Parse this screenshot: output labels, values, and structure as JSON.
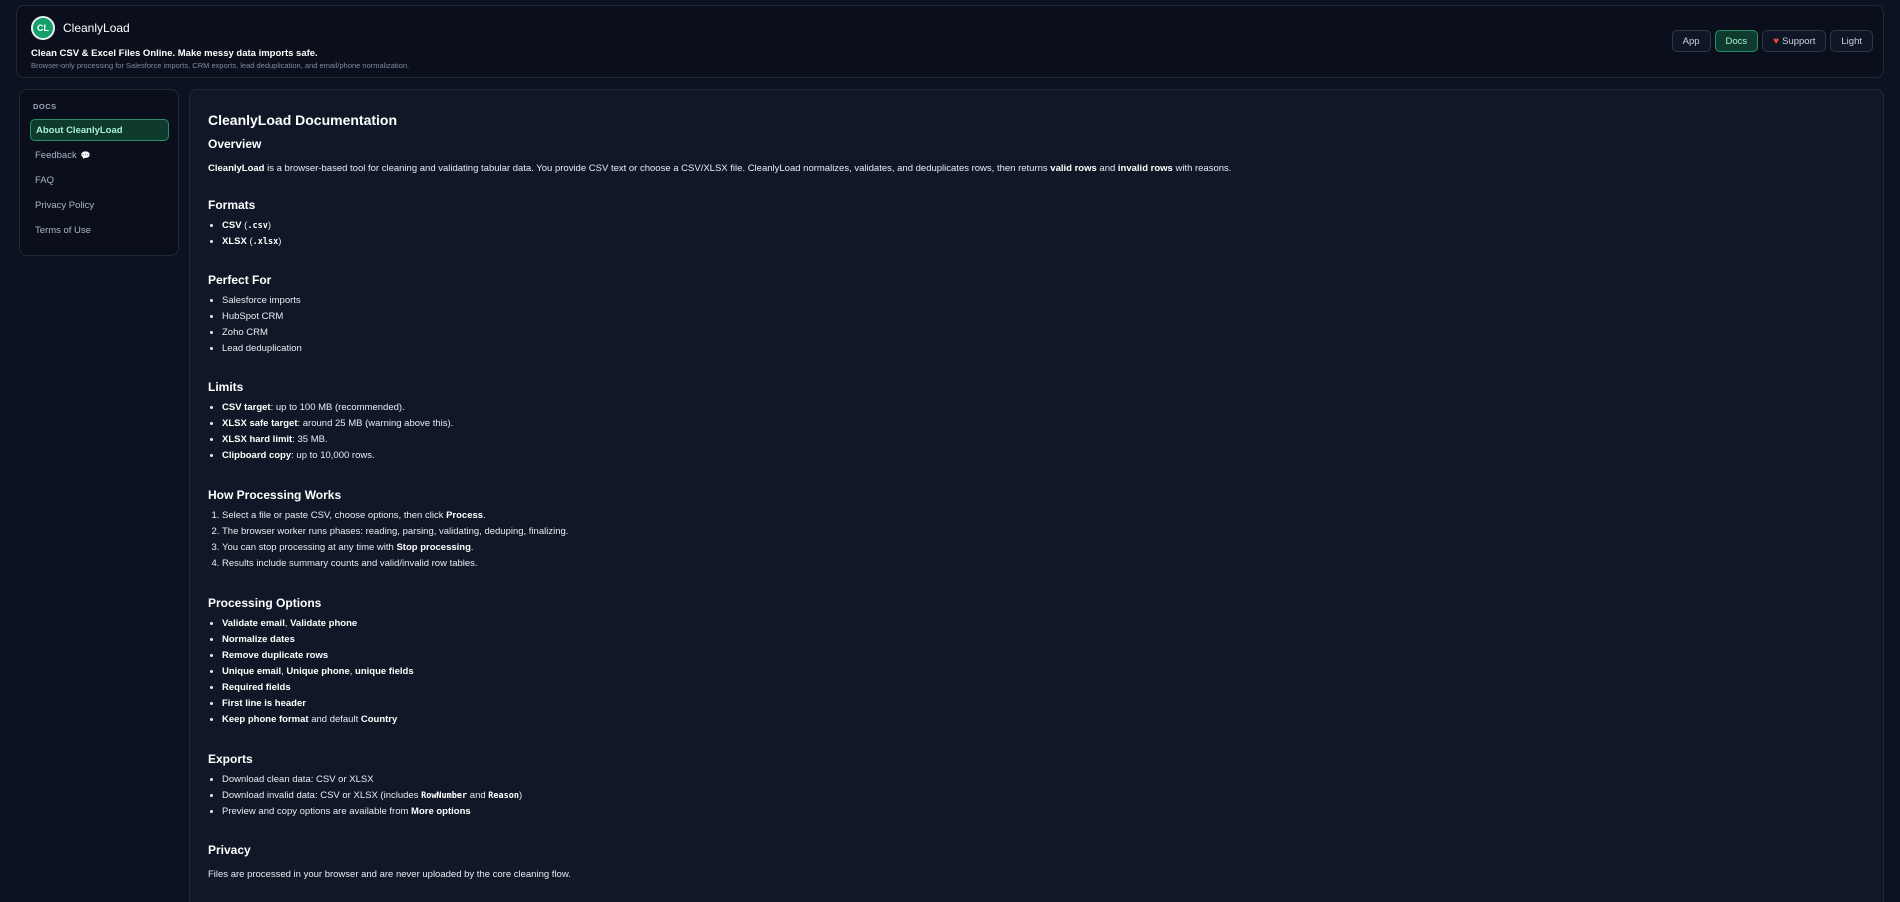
{
  "header": {
    "logo_text": "CL",
    "brand": "CleanlyLoad",
    "tagline": "Clean CSV & Excel Files Online. Make messy data imports safe.",
    "subtagline": "Browser-only processing for Salesforce imports, CRM exports, lead deduplication, and email/phone normalization.",
    "nav": {
      "app": "App",
      "docs": "Docs",
      "support": "Support",
      "theme": "Light"
    }
  },
  "sidebar": {
    "title": "DOCS",
    "items": [
      "About CleanlyLoad",
      "Feedback",
      "FAQ",
      "Privacy Policy",
      "Terms of Use"
    ]
  },
  "doc": {
    "title": "CleanlyLoad Documentation",
    "overview": {
      "heading": "Overview",
      "brand": "CleanlyLoad",
      "text1": " is a browser-based tool for cleaning and validating tabular data. You provide CSV text or choose a CSV/XLSX file. CleanlyLoad normalizes, validates, and deduplicates rows, then returns ",
      "valid": "valid rows",
      "and": " and ",
      "invalid": "invalid rows",
      "text2": " with reasons."
    },
    "formats": {
      "heading": "Formats",
      "items": [
        {
          "name": "CSV",
          "ext": ".csv"
        },
        {
          "name": "XLSX",
          "ext": ".xlsx"
        }
      ]
    },
    "perfect": {
      "heading": "Perfect For",
      "items": [
        "Salesforce imports",
        "HubSpot CRM",
        "Zoho CRM",
        "Lead deduplication"
      ]
    },
    "limits": {
      "heading": "Limits",
      "items": [
        {
          "k": "CSV target",
          "v": ": up to 100 MB (recommended)."
        },
        {
          "k": "XLSX safe target",
          "v": ": around 25 MB (warning above this)."
        },
        {
          "k": "XLSX hard limit",
          "v": ": 35 MB."
        },
        {
          "k": "Clipboard copy",
          "v": ": up to 10,000 rows."
        }
      ]
    },
    "processing": {
      "heading": "How Processing Works",
      "s1a": "Select a file or paste CSV, choose options, then click ",
      "s1b": "Process",
      "s1c": ".",
      "s2": "The browser worker runs phases: reading, parsing, validating, deduping, finalizing.",
      "s3a": "You can stop processing at any time with ",
      "s3b": "Stop processing",
      "s3c": ".",
      "s4": "Results include summary counts and valid/invalid row tables."
    },
    "options": {
      "heading": "Processing Options",
      "o1a": "Validate email",
      "o1b": "Validate phone",
      "o2": "Normalize dates",
      "o3": "Remove duplicate rows",
      "o4a": "Unique email",
      "o4b": "Unique phone",
      "o4c": "unique fields",
      "o5": "Required fields",
      "o6": "First line is header",
      "o7a": "Keep phone format",
      "o7b": " and default ",
      "o7c": "Country",
      "comma": ", "
    },
    "exports": {
      "heading": "Exports",
      "e1": "Download clean data: CSV or XLSX",
      "e2a": "Download invalid data: CSV or XLSX (includes ",
      "e2b": "RowNumber",
      "e2c": " and ",
      "e2d": "Reason",
      "e2e": ")",
      "e3a": "Preview and copy options are available from ",
      "e3b": "More options"
    },
    "privacy": {
      "heading": "Privacy",
      "text": "Files are processed in your browser and are never uploaded by the core cleaning flow."
    }
  }
}
